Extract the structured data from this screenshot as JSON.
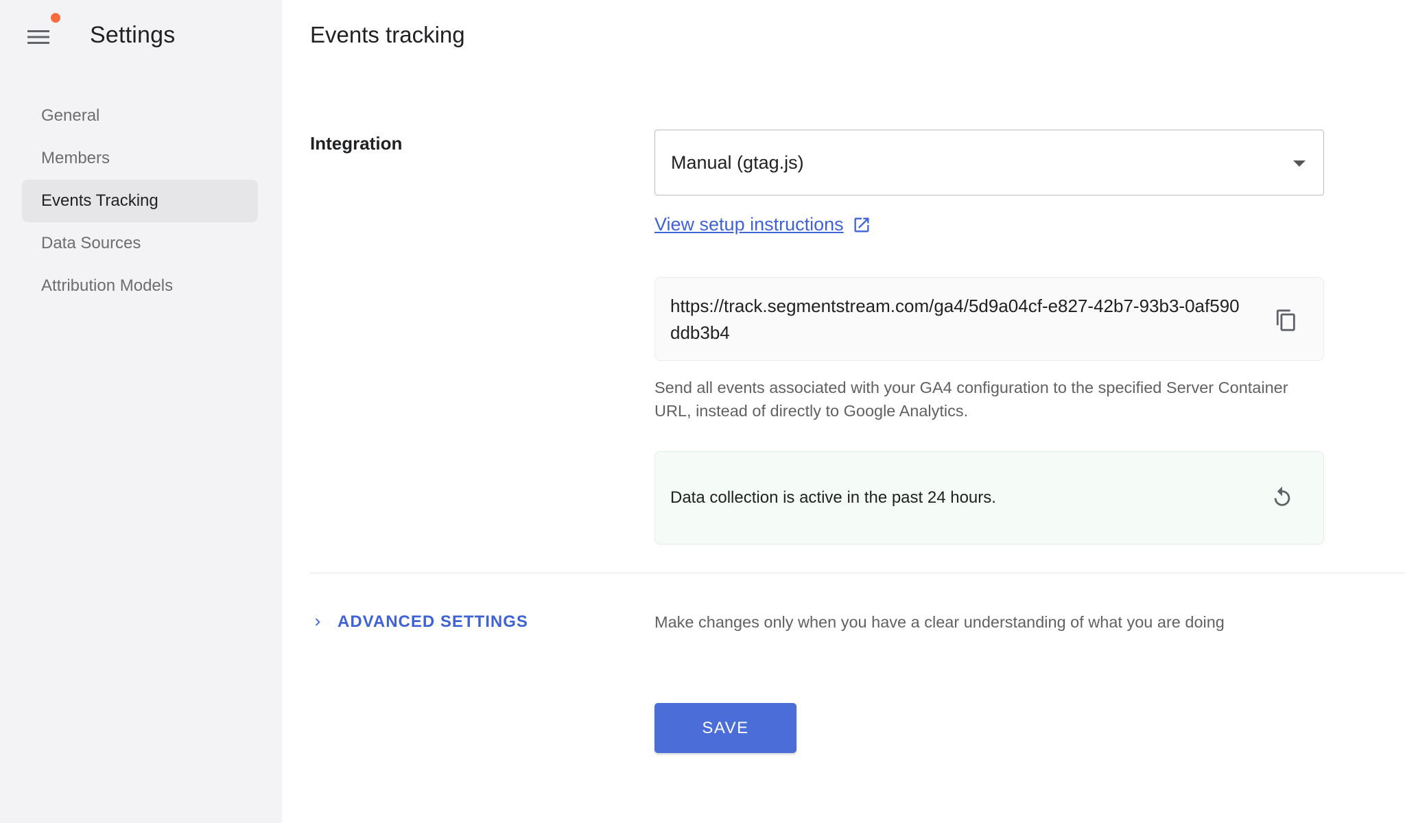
{
  "sidebar": {
    "title": "Settings",
    "items": [
      {
        "label": "General",
        "active": false
      },
      {
        "label": "Members",
        "active": false
      },
      {
        "label": "Events Tracking",
        "active": true
      },
      {
        "label": "Data Sources",
        "active": false
      },
      {
        "label": "Attribution Models",
        "active": false
      }
    ]
  },
  "main": {
    "title": "Events tracking",
    "integration": {
      "label": "Integration",
      "selected": "Manual (gtag.js)",
      "setup_link": "View setup instructions"
    },
    "server_url": "https://track.segmentstream.com/ga4/5d9a04cf-e827-42b7-93b3-0af590ddb3b4",
    "help_text": "Send all events associated with your GA4 configuration to the specified Server Container URL, instead of directly to Google Analytics.",
    "status": "Data collection is active in the past 24 hours.",
    "advanced": {
      "label": "ADVANCED SETTINGS",
      "note": "Make changes only when you have a clear understanding of what you are doing"
    },
    "save_label": "SAVE"
  },
  "colors": {
    "accent": "#4b6dd8",
    "link": "#3f63d4",
    "notification": "#f76b3f",
    "status_bg": "#f5fbf7"
  },
  "icons": {
    "menu": "hamburger-menu-icon",
    "external": "external-link-icon",
    "copy": "copy-icon",
    "refresh": "refresh-icon",
    "caret": "dropdown-caret-icon",
    "chevron": "chevron-right-icon"
  }
}
